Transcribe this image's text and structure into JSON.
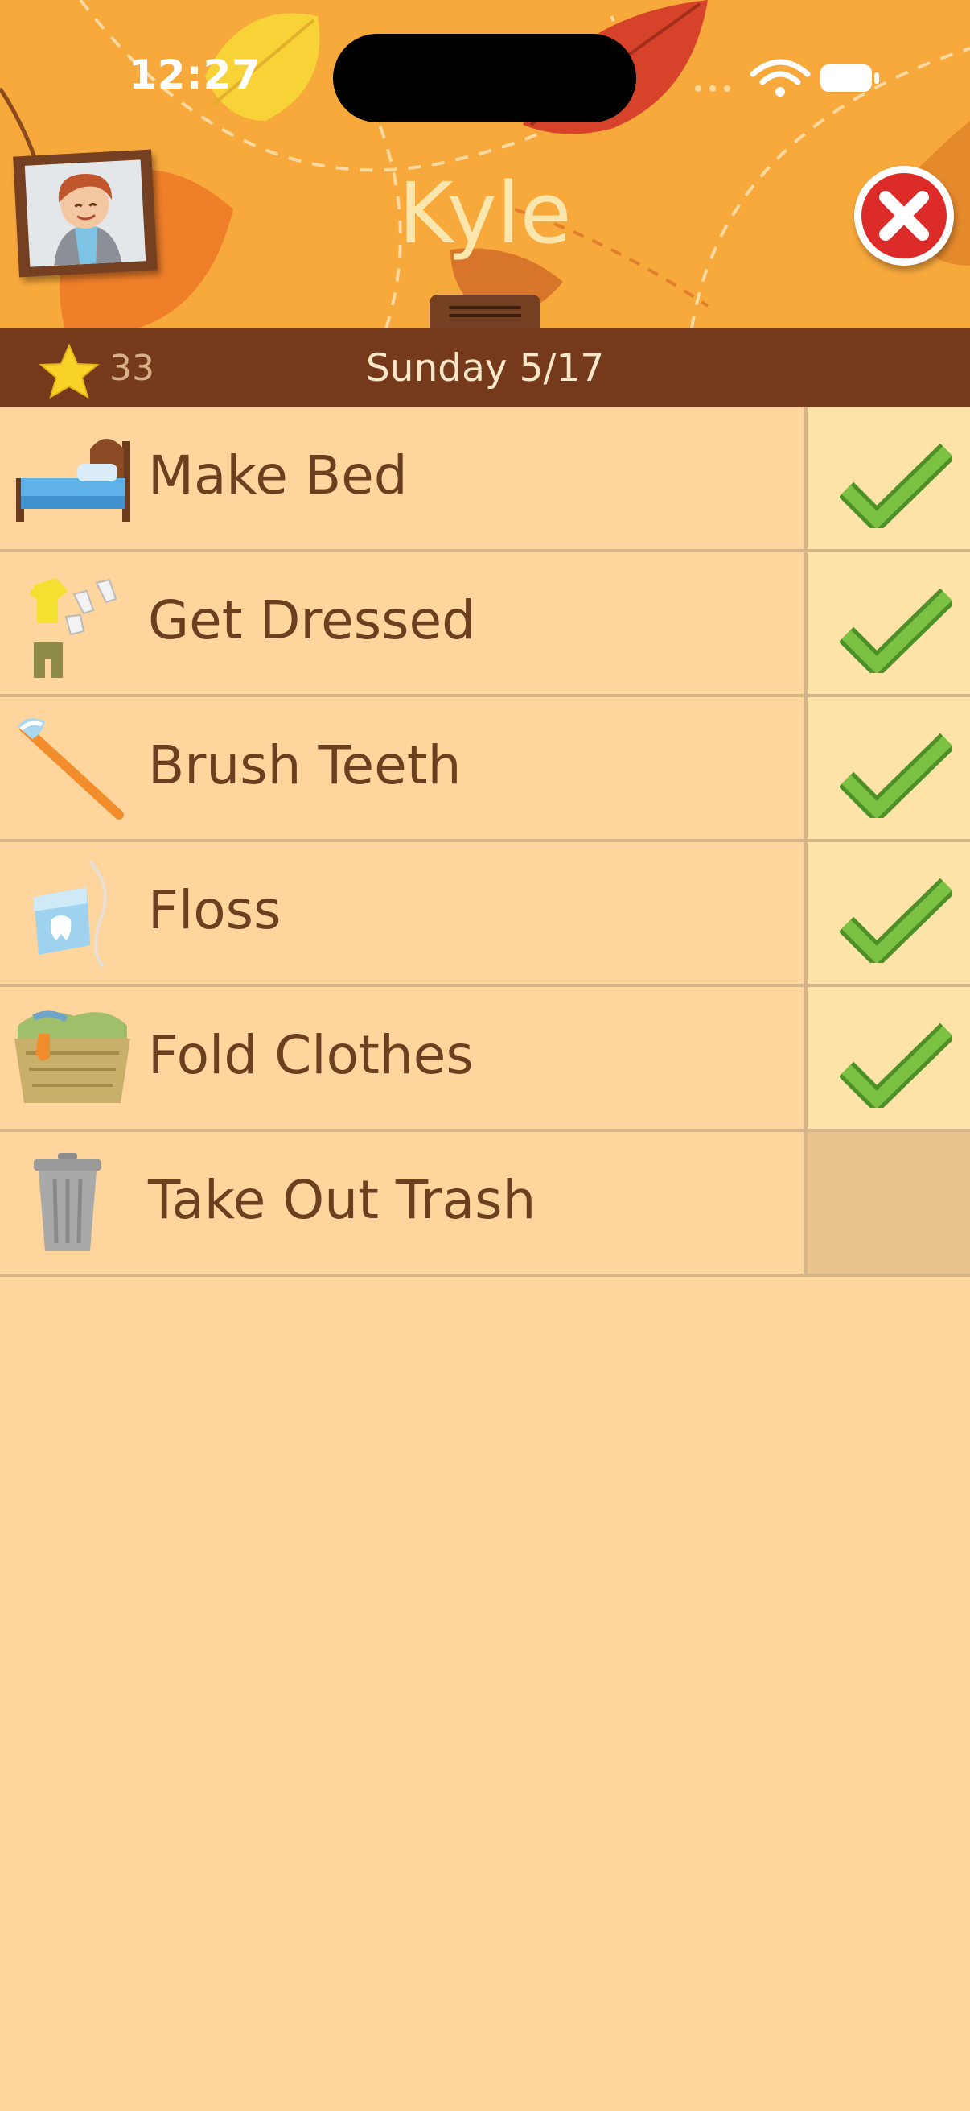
{
  "status_bar": {
    "time": "12:27"
  },
  "header": {
    "title": "Kyle"
  },
  "subbar": {
    "star_count": "33",
    "date": "Sunday 5/17"
  },
  "chores": [
    {
      "label": "Make Bed",
      "icon": "bed-icon",
      "completed": true
    },
    {
      "label": "Get Dressed",
      "icon": "clothes-icon",
      "completed": true
    },
    {
      "label": "Brush Teeth",
      "icon": "toothbrush-icon",
      "completed": true
    },
    {
      "label": "Floss",
      "icon": "floss-icon",
      "completed": true
    },
    {
      "label": "Fold Clothes",
      "icon": "laundry-basket-icon",
      "completed": true
    },
    {
      "label": "Take Out Trash",
      "icon": "trash-can-icon",
      "completed": false
    }
  ],
  "colors": {
    "header_bg": "#f8a93c",
    "subbar_bg": "#743a1b",
    "list_bg": "#fdd59d",
    "check_green": "#6fb63c",
    "close_red": "#dd2b2a"
  }
}
